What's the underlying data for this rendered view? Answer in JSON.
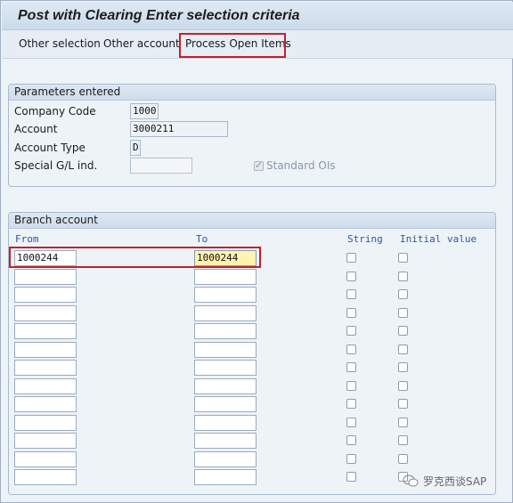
{
  "window": {
    "title": "Post with Clearing Enter selection criteria"
  },
  "toolbar": {
    "other_selection": "Other selection",
    "other_account": "Other account",
    "process_open_items": "Process Open Items"
  },
  "parameters": {
    "heading": "Parameters entered",
    "company_code_label": "Company Code",
    "company_code_value": "1000",
    "account_label": "Account",
    "account_value": "3000211",
    "account_type_label": "Account Type",
    "account_type_value": "D",
    "special_gl_label": "Special G/L ind.",
    "special_gl_value": "",
    "standard_ois_label": "Standard OIs",
    "standard_ois_checked": true
  },
  "branch": {
    "heading": "Branch account",
    "col_from": "From",
    "col_to": "To",
    "col_string": "String",
    "col_initial": "Initial value",
    "rows": [
      {
        "from": "1000244",
        "to": "1000244"
      },
      {
        "from": "",
        "to": ""
      },
      {
        "from": "",
        "to": ""
      },
      {
        "from": "",
        "to": ""
      },
      {
        "from": "",
        "to": ""
      },
      {
        "from": "",
        "to": ""
      },
      {
        "from": "",
        "to": ""
      },
      {
        "from": "",
        "to": ""
      },
      {
        "from": "",
        "to": ""
      },
      {
        "from": "",
        "to": ""
      },
      {
        "from": "",
        "to": ""
      },
      {
        "from": "",
        "to": ""
      },
      {
        "from": "",
        "to": ""
      }
    ]
  },
  "watermark": {
    "text": "罗克西谈SAP"
  },
  "colors": {
    "highlight": "#c0232b",
    "column_header": "#2b55a8"
  }
}
